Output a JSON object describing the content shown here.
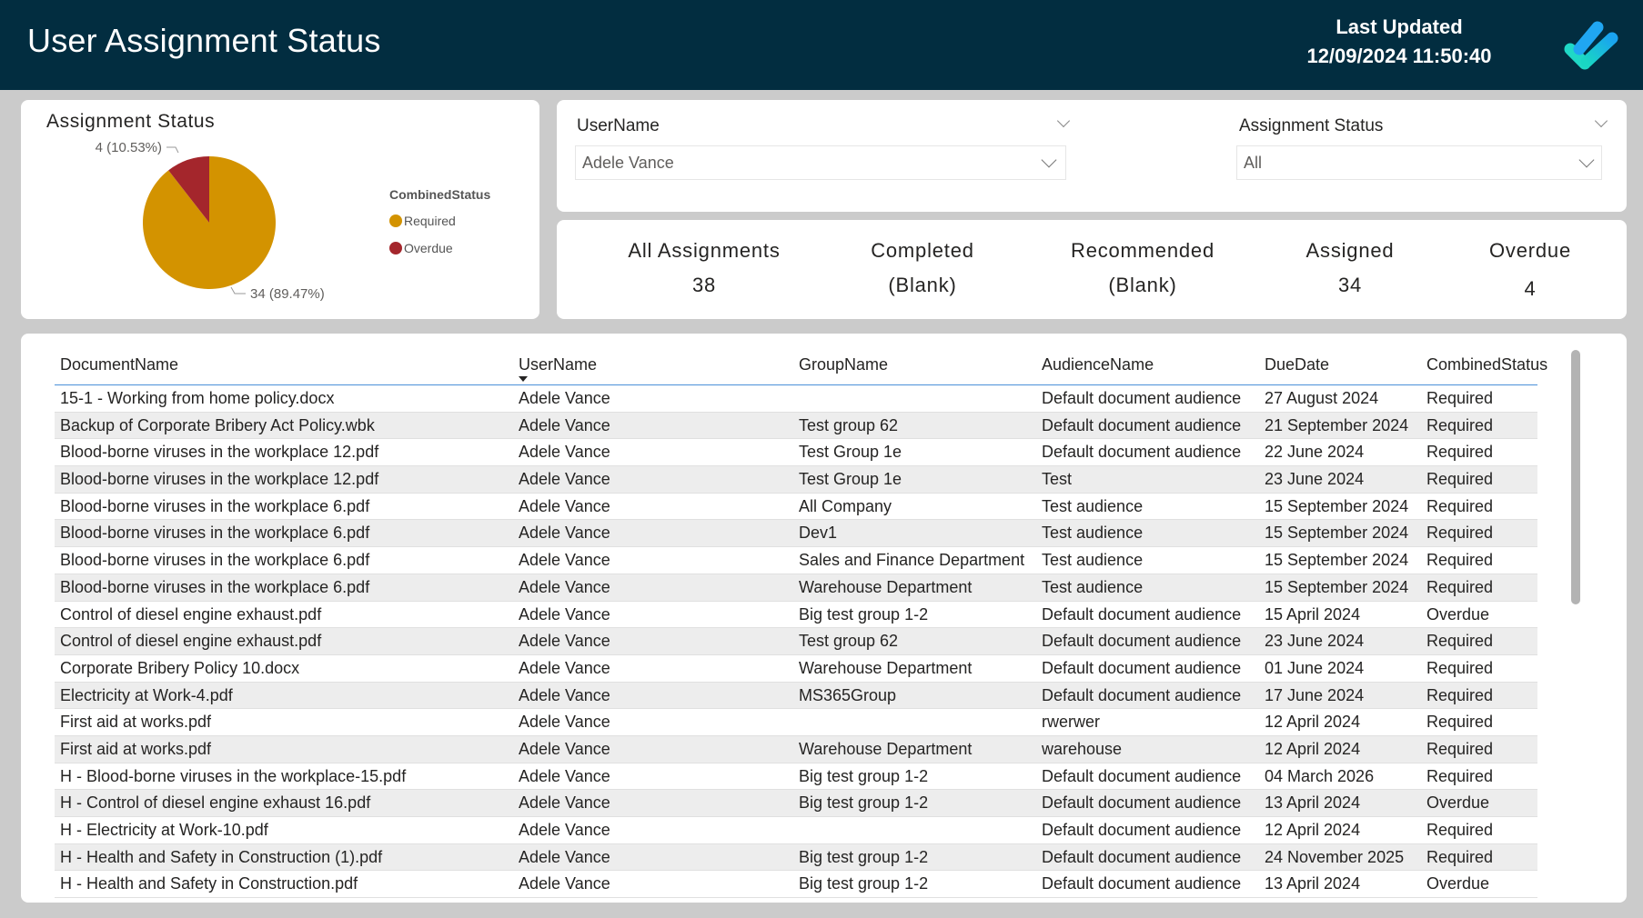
{
  "header": {
    "title": "User Assignment Status",
    "last_updated_label": "Last Updated",
    "last_updated_value": "12/09/2024 11:50:40",
    "logo_icon": "checkmark-logo-icon"
  },
  "pie": {
    "title": "Assignment Status",
    "legend_title": "CombinedStatus",
    "labels": [
      "4 (10.53%)",
      "34 (89.47%)"
    ]
  },
  "chart_data": {
    "type": "pie",
    "title": "Assignment Status",
    "legend_title": "CombinedStatus",
    "legend_position": "right",
    "categories": [
      "Required",
      "Overdue"
    ],
    "values": [
      34,
      4
    ],
    "percents": [
      89.47,
      10.53
    ],
    "colors": [
      "#d39300",
      "#a4262c"
    ],
    "data_labels": [
      "34 (89.47%)",
      "4 (10.53%)"
    ]
  },
  "slicers": {
    "username": {
      "label": "UserName",
      "value": "Adele Vance"
    },
    "assignment_status": {
      "label": "Assignment Status",
      "value": "All"
    }
  },
  "kpis": [
    {
      "label": "All Assignments",
      "value": "38"
    },
    {
      "label": "Completed",
      "value": "(Blank)"
    },
    {
      "label": "Recommended",
      "value": "(Blank)"
    },
    {
      "label": "Assigned",
      "value": "34"
    },
    {
      "label": "Overdue",
      "value": "4"
    }
  ],
  "table": {
    "columns": [
      "DocumentName",
      "UserName",
      "GroupName",
      "AudienceName",
      "DueDate",
      "CombinedStatus"
    ],
    "sorted_column": "UserName",
    "rows": [
      [
        "15-1 - Working from home policy.docx",
        "Adele Vance",
        "",
        "Default document audience",
        "27 August 2024",
        "Required"
      ],
      [
        "Backup of Corporate Bribery Act Policy.wbk",
        "Adele Vance",
        "Test group 62",
        "Default document audience",
        "21 September 2024",
        "Required"
      ],
      [
        "Blood-borne viruses in the workplace 12.pdf",
        "Adele Vance",
        "Test Group 1e",
        "Default document audience",
        "22 June 2024",
        "Required"
      ],
      [
        "Blood-borne viruses in the workplace 12.pdf",
        "Adele Vance",
        "Test Group 1e",
        "Test",
        "23 June 2024",
        "Required"
      ],
      [
        "Blood-borne viruses in the workplace 6.pdf",
        "Adele Vance",
        "All Company",
        "Test audience",
        "15 September 2024",
        "Required"
      ],
      [
        "Blood-borne viruses in the workplace 6.pdf",
        "Adele Vance",
        "Dev1",
        "Test audience",
        "15 September 2024",
        "Required"
      ],
      [
        "Blood-borne viruses in the workplace 6.pdf",
        "Adele Vance",
        "Sales and Finance Department",
        "Test audience",
        "15 September 2024",
        "Required"
      ],
      [
        "Blood-borne viruses in the workplace 6.pdf",
        "Adele Vance",
        "Warehouse Department",
        "Test audience",
        "15 September 2024",
        "Required"
      ],
      [
        "Control of diesel engine exhaust.pdf",
        "Adele Vance",
        "Big test group 1-2",
        "Default document audience",
        "15 April 2024",
        "Overdue"
      ],
      [
        "Control of diesel engine exhaust.pdf",
        "Adele Vance",
        "Test group 62",
        "Default document audience",
        "23 June 2024",
        "Required"
      ],
      [
        "Corporate Bribery Policy 10.docx",
        "Adele Vance",
        "Warehouse Department",
        "Default document audience",
        "01 June 2024",
        "Required"
      ],
      [
        "Electricity at Work-4.pdf",
        "Adele Vance",
        "MS365Group",
        "Default document audience",
        "17 June 2024",
        "Required"
      ],
      [
        "First aid at works.pdf",
        "Adele Vance",
        "",
        "rwerwer",
        "12 April 2024",
        "Required"
      ],
      [
        "First aid at works.pdf",
        "Adele Vance",
        "Warehouse Department",
        "warehouse",
        "12 April 2024",
        "Required"
      ],
      [
        "H - Blood-borne viruses in the workplace-15.pdf",
        "Adele Vance",
        "Big test group 1-2",
        "Default document audience",
        "04 March 2026",
        "Required"
      ],
      [
        "H - Control of diesel engine exhaust 16.pdf",
        "Adele Vance",
        "Big test group 1-2",
        "Default document audience",
        "13 April 2024",
        "Overdue"
      ],
      [
        "H - Electricity at Work-10.pdf",
        "Adele Vance",
        "",
        "Default document audience",
        "12 April 2024",
        "Required"
      ],
      [
        "H - Health and Safety in Construction (1).pdf",
        "Adele Vance",
        "Big test group 1-2",
        "Default document audience",
        "24 November 2025",
        "Required"
      ],
      [
        "H - Health and Safety in Construction.pdf",
        "Adele Vance",
        "Big test group 1-2",
        "Default document audience",
        "13 April 2024",
        "Overdue"
      ]
    ]
  }
}
